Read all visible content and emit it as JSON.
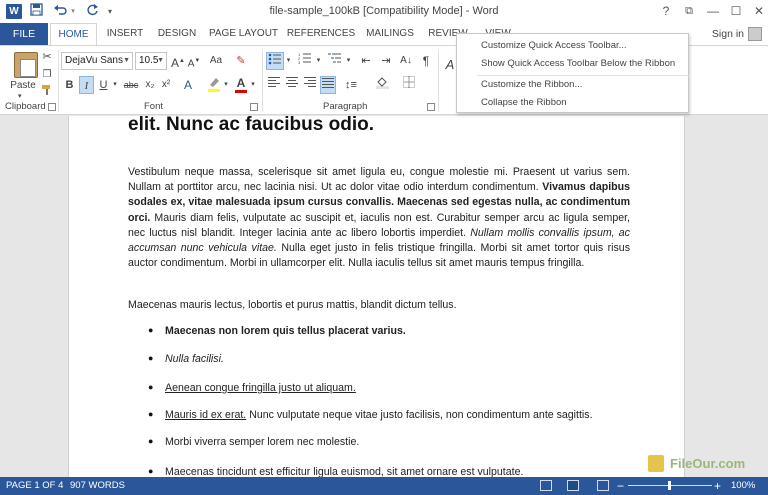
{
  "window": {
    "title": "file-sample_100kB [Compatibility Mode] - Word",
    "help": "?",
    "restore_ribbon": "⧉",
    "minimize": "—",
    "maximize": "☐",
    "close": "✕"
  },
  "app_logo": "W",
  "qat": {
    "save_icon": "save-icon",
    "undo_icon": "undo-icon",
    "redo_icon": "redo-icon",
    "customize_icon": "chevron-down-icon"
  },
  "tabs": {
    "file": "FILE",
    "items": [
      "HOME",
      "INSERT",
      "DESIGN",
      "PAGE LAYOUT",
      "REFERENCES",
      "MAILINGS",
      "REVIEW",
      "VIEW"
    ],
    "active": "HOME",
    "signin": "Sign in"
  },
  "ribbon": {
    "clipboard": {
      "label": "Clipboard",
      "paste": "Paste"
    },
    "font": {
      "label": "Font",
      "font_name": "DejaVu Sans",
      "font_size": "10.5",
      "grow": "A",
      "shrink": "A",
      "case": "Aa",
      "bold": "B",
      "italic": "I",
      "underline": "U",
      "strike": "abc",
      "subscript": "x₂",
      "superscript": "x²",
      "font_color": "A"
    },
    "paragraph": {
      "label": "Paragraph",
      "pilcrow": "¶"
    }
  },
  "menu": {
    "items": [
      "Customize Quick Access Toolbar...",
      "Show Quick Access Toolbar Below the Ribbon",
      "Customize the Ribbon...",
      "Collapse the Ribbon"
    ]
  },
  "document": {
    "heading": "elit. Nunc ac faucibus odio.",
    "para1_parts": [
      {
        "t": "Vestibulum neque massa, scelerisque sit amet ligula eu, congue molestie mi. Praesent ut varius sem. Nullam at porttitor arcu, nec lacinia nisi. Ut ac dolor vitae odio interdum condimentum. ",
        "s": "n"
      },
      {
        "t": "Vivamus dapibus sodales ex, vitae malesuada ipsum cursus convallis. Maecenas sed egestas nulla, ac condimentum orci.",
        "s": "b"
      },
      {
        "t": " Mauris diam felis, vulputate ac suscipit et, iaculis non est. Curabitur semper arcu ac ligula semper, nec luctus nisl blandit. Integer lacinia ante ac libero lobortis imperdiet. ",
        "s": "n"
      },
      {
        "t": "Nullam mollis convallis ipsum, ac accumsan nunc vehicula vitae.",
        "s": "i"
      },
      {
        "t": " Nulla eget justo in felis tristique fringilla. Morbi sit amet tortor quis risus auctor condimentum. Morbi in ullamcorper elit. Nulla iaculis tellus sit amet mauris tempus fringilla.",
        "s": "n"
      }
    ],
    "para2": "Maecenas mauris lectus, lobortis et purus mattis, blandit dictum tellus.",
    "bullets": [
      {
        "text": "Maecenas non lorem quis tellus placerat varius.",
        "style": "bold"
      },
      {
        "text": "Nulla facilisi.",
        "style": "italic"
      },
      {
        "text": "Aenean congue fringilla justo ut aliquam.",
        "style": "underline"
      },
      {
        "text": "Mauris id ex erat.",
        "style": "underline",
        "rest": " Nunc vulputate neque vitae justo facilisis, non condimentum ante sagittis."
      },
      {
        "text": "Morbi viverra semper lorem nec molestie.",
        "style": "normal"
      },
      {
        "text": "Maecenas tincidunt est efficitur ligula euismod, sit amet ornare est vulputate.",
        "style": "normal"
      }
    ]
  },
  "status": {
    "page": "PAGE 1 OF 4",
    "words": "907 WORDS",
    "zoom_minus": "−",
    "zoom_plus": "+",
    "zoom": "100%"
  },
  "watermark": "FileOur.com",
  "colors": {
    "accent": "#2b579a",
    "highlight": "#ffff00",
    "font_color": "#e00000"
  }
}
